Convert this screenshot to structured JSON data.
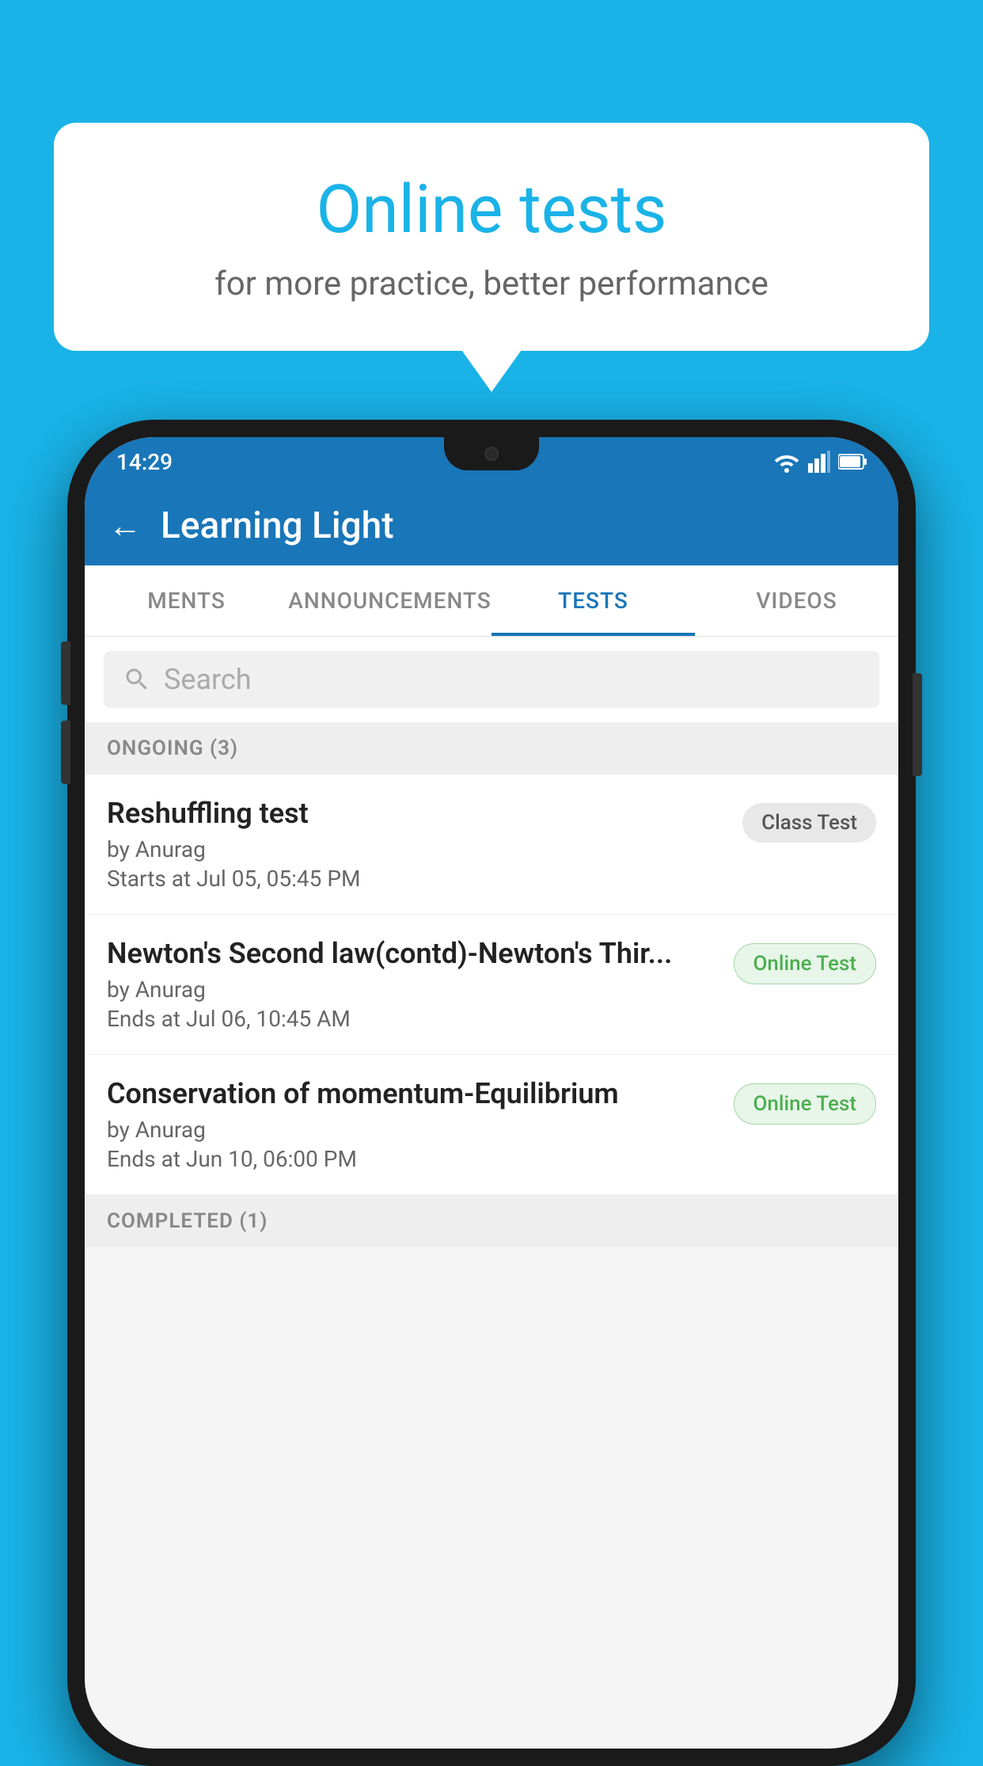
{
  "background": {
    "color": "#1ab3e8"
  },
  "speechBubble": {
    "title": "Online tests",
    "subtitle": "for more practice, better performance"
  },
  "phone": {
    "statusBar": {
      "time": "14:29",
      "icons": [
        "wifi",
        "signal",
        "battery"
      ]
    },
    "appBar": {
      "title": "Learning Light",
      "backLabel": "←"
    },
    "tabs": [
      {
        "label": "MENTS",
        "active": false
      },
      {
        "label": "ANNOUNCEMENTS",
        "active": false
      },
      {
        "label": "TESTS",
        "active": true
      },
      {
        "label": "VIDEOS",
        "active": false
      }
    ],
    "search": {
      "placeholder": "Search"
    },
    "sections": [
      {
        "header": "ONGOING (3)",
        "items": [
          {
            "title": "Reshuffling test",
            "author": "by Anurag",
            "date": "Starts at  Jul 05, 05:45 PM",
            "badge": "Class Test",
            "badgeType": "class"
          },
          {
            "title": "Newton's Second law(contd)-Newton's Thir...",
            "author": "by Anurag",
            "date": "Ends at  Jul 06, 10:45 AM",
            "badge": "Online Test",
            "badgeType": "online"
          },
          {
            "title": "Conservation of momentum-Equilibrium",
            "author": "by Anurag",
            "date": "Ends at  Jun 10, 06:00 PM",
            "badge": "Online Test",
            "badgeType": "online"
          }
        ]
      },
      {
        "header": "COMPLETED (1)",
        "items": []
      }
    ]
  }
}
